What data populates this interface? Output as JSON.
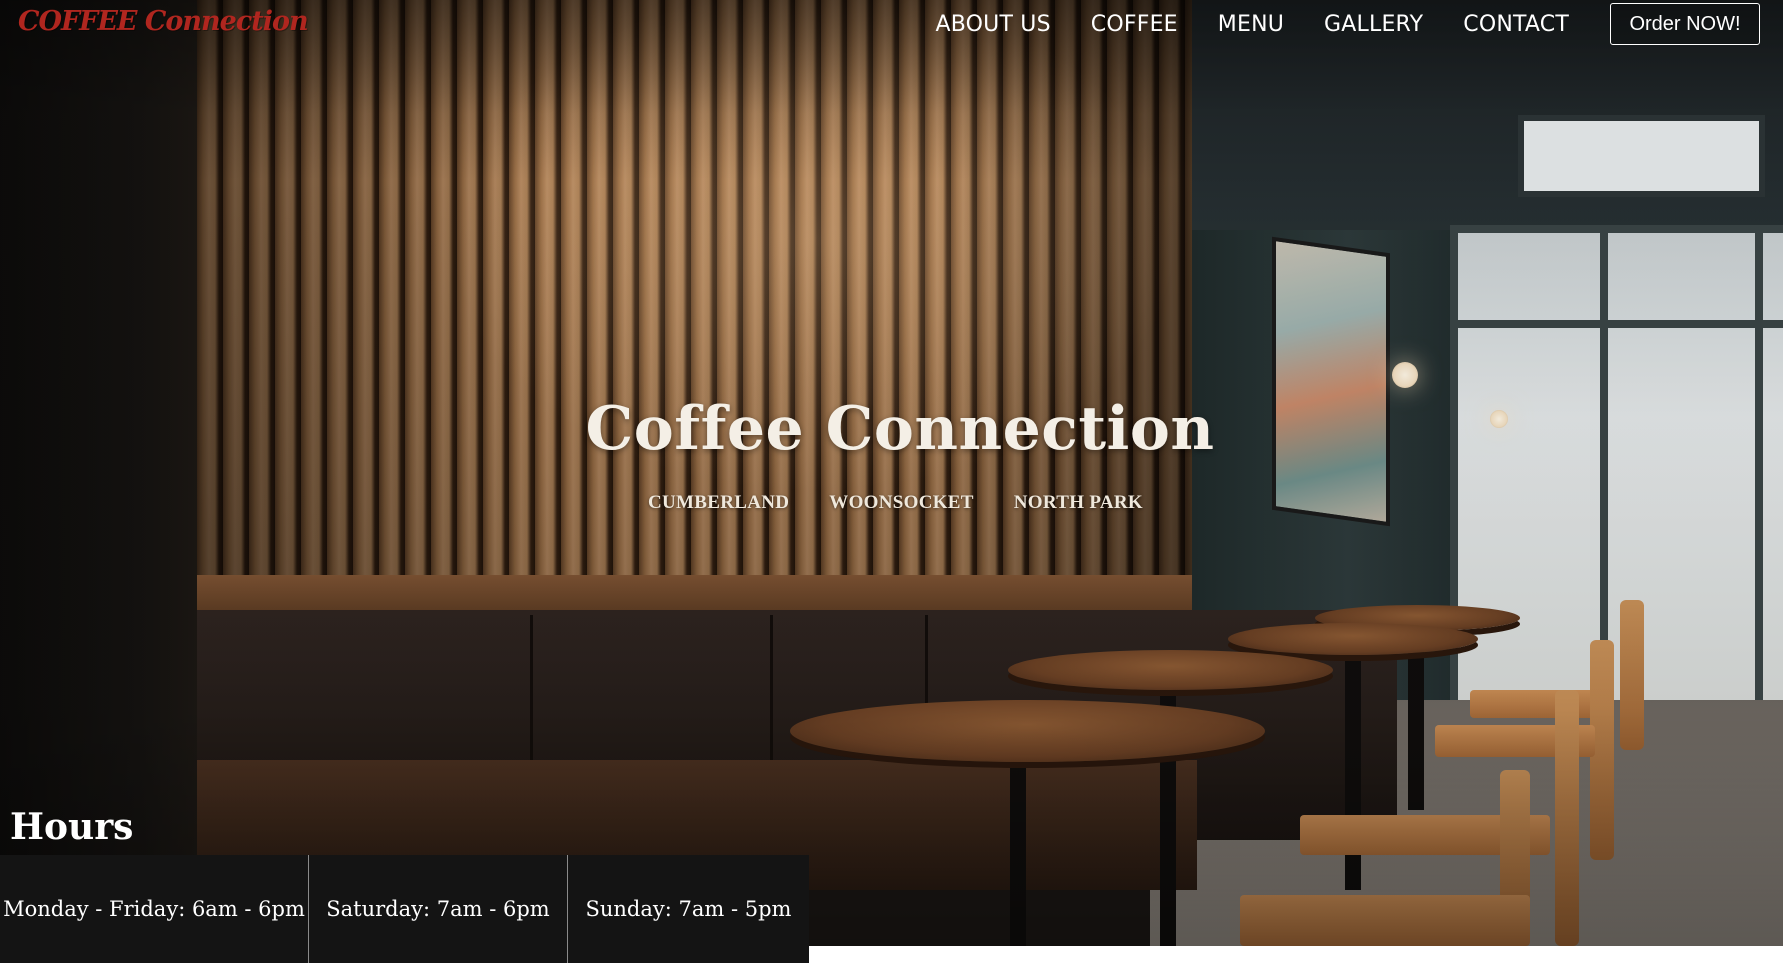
{
  "brand": {
    "logo_text": "COFFEE Connection",
    "logo_color": "#b0261f"
  },
  "nav": {
    "links": [
      {
        "label": "ABOUT US"
      },
      {
        "label": "COFFEE"
      },
      {
        "label": "MENU"
      },
      {
        "label": "GALLERY"
      },
      {
        "label": "CONTACT"
      }
    ],
    "cta_label": "Order NOW!"
  },
  "hero": {
    "title": "Coffee Connection",
    "locations": [
      "CUMBERLAND",
      "WOONSOCKET",
      "NORTH PARK"
    ]
  },
  "hours": {
    "heading": "Hours",
    "entries": [
      {
        "text": "Monday - Friday: 6am - 6pm"
      },
      {
        "text": "Saturday: 7am - 6pm"
      },
      {
        "text": "Sunday: 7am - 5pm"
      }
    ]
  },
  "colors": {
    "hours_bg": "#141414",
    "text_light": "#ffffff"
  }
}
